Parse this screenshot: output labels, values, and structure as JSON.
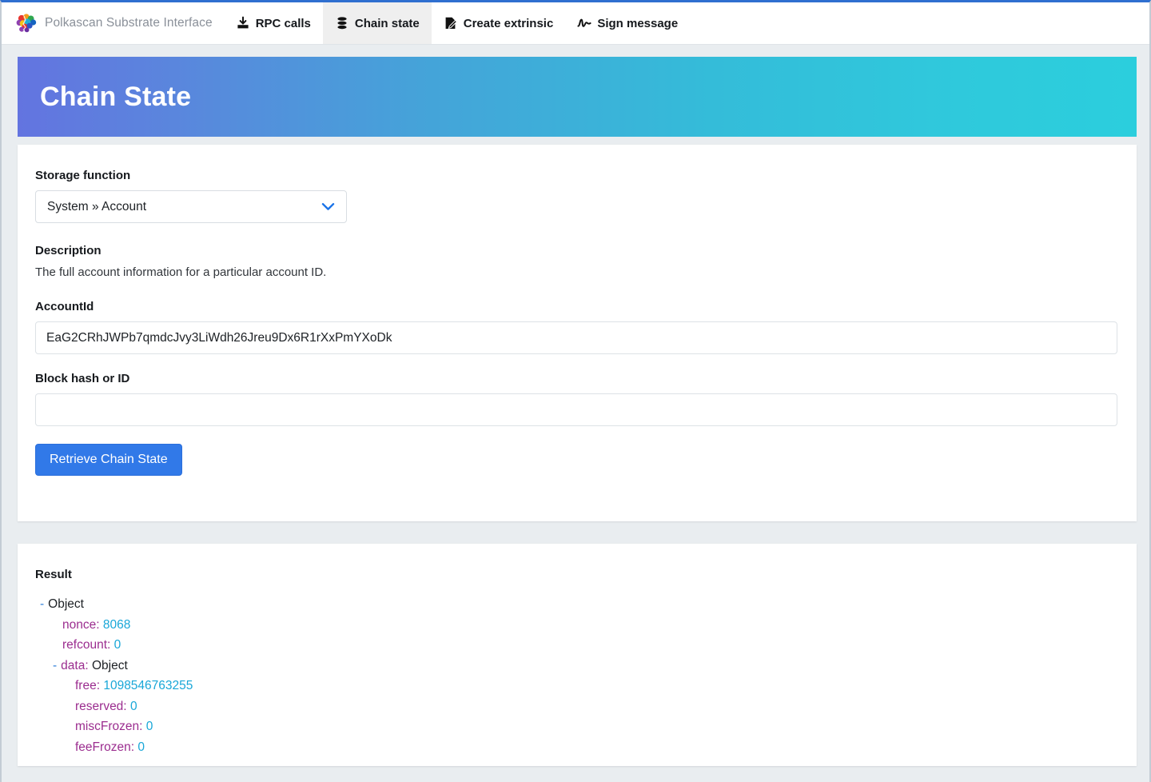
{
  "navbar": {
    "brand": "Polkascan Substrate Interface",
    "brand_logo_icon": "polkascan-brain-logo",
    "tabs": [
      {
        "label": "RPC calls",
        "icon": "download-icon",
        "active": false
      },
      {
        "label": "Chain state",
        "icon": "database-icon",
        "active": true
      },
      {
        "label": "Create extrinsic",
        "icon": "document-pen-icon",
        "active": false
      },
      {
        "label": "Sign message",
        "icon": "signature-icon",
        "active": false
      }
    ]
  },
  "banner": {
    "title": "Chain State",
    "gradient_from": "#6374e0",
    "gradient_to": "#2bcedd"
  },
  "query_form": {
    "storage_function_label": "Storage function",
    "storage_function_value": "System » Account",
    "chevron_icon": "chevron-down-icon",
    "chevron_color": "#1a73e8",
    "description_label": "Description",
    "description_text": "The full account information for a particular account ID.",
    "account_id_label": "AccountId",
    "account_id_value": "EaG2CRhJWPb7qmdcJvy3LiWdh26Jreu9Dx6R1rXxPmYXoDk",
    "account_id_placeholder": "",
    "block_hash_label": "Block hash or ID",
    "block_hash_value": "",
    "block_hash_placeholder": "",
    "submit_label": "Retrieve Chain State",
    "submit_color": "#3179e8"
  },
  "result": {
    "title": "Result",
    "root_toggle": "-",
    "root_type": "Object",
    "nonce_key": "nonce:",
    "nonce_value": "8068",
    "refcount_key": "refcount:",
    "refcount_value": "0",
    "data_toggle": "-",
    "data_key": "data:",
    "data_type": "Object",
    "free_key": "free:",
    "free_value": "1098546763255",
    "reserved_key": "reserved:",
    "reserved_value": "0",
    "misc_frozen_key": "miscFrozen:",
    "misc_frozen_value": "0",
    "fee_frozen_key": "feeFrozen:",
    "fee_frozen_value": "0",
    "key_color": "#9b2d8f",
    "value_color": "#19a7d8"
  }
}
